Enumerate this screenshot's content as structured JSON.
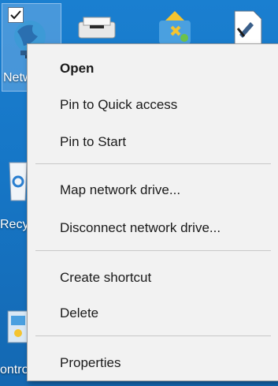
{
  "desktop": {
    "icons": [
      {
        "label": "Netw",
        "icon": "network-icon"
      },
      {
        "label": "",
        "icon": "printer-icon"
      },
      {
        "label": "",
        "icon": "app-icon"
      },
      {
        "label": "",
        "icon": "document-icon"
      },
      {
        "label": "Recyc",
        "icon": "recycle-bin-icon"
      },
      {
        "label": "ontro",
        "icon": "control-panel-icon"
      }
    ]
  },
  "context_menu": {
    "items": [
      {
        "label": "Open",
        "bold": true
      },
      {
        "label": "Pin to Quick access"
      },
      {
        "label": "Pin to Start"
      },
      {
        "label": "Map network drive..."
      },
      {
        "label": "Disconnect network drive..."
      },
      {
        "label": "Create shortcut"
      },
      {
        "label": "Delete"
      },
      {
        "label": "Properties"
      }
    ]
  },
  "colors": {
    "desktop_background": "#1676c6",
    "menu_background": "#f2f2f2",
    "menu_text": "#1a1a1a",
    "separator": "#c8c8c8"
  }
}
